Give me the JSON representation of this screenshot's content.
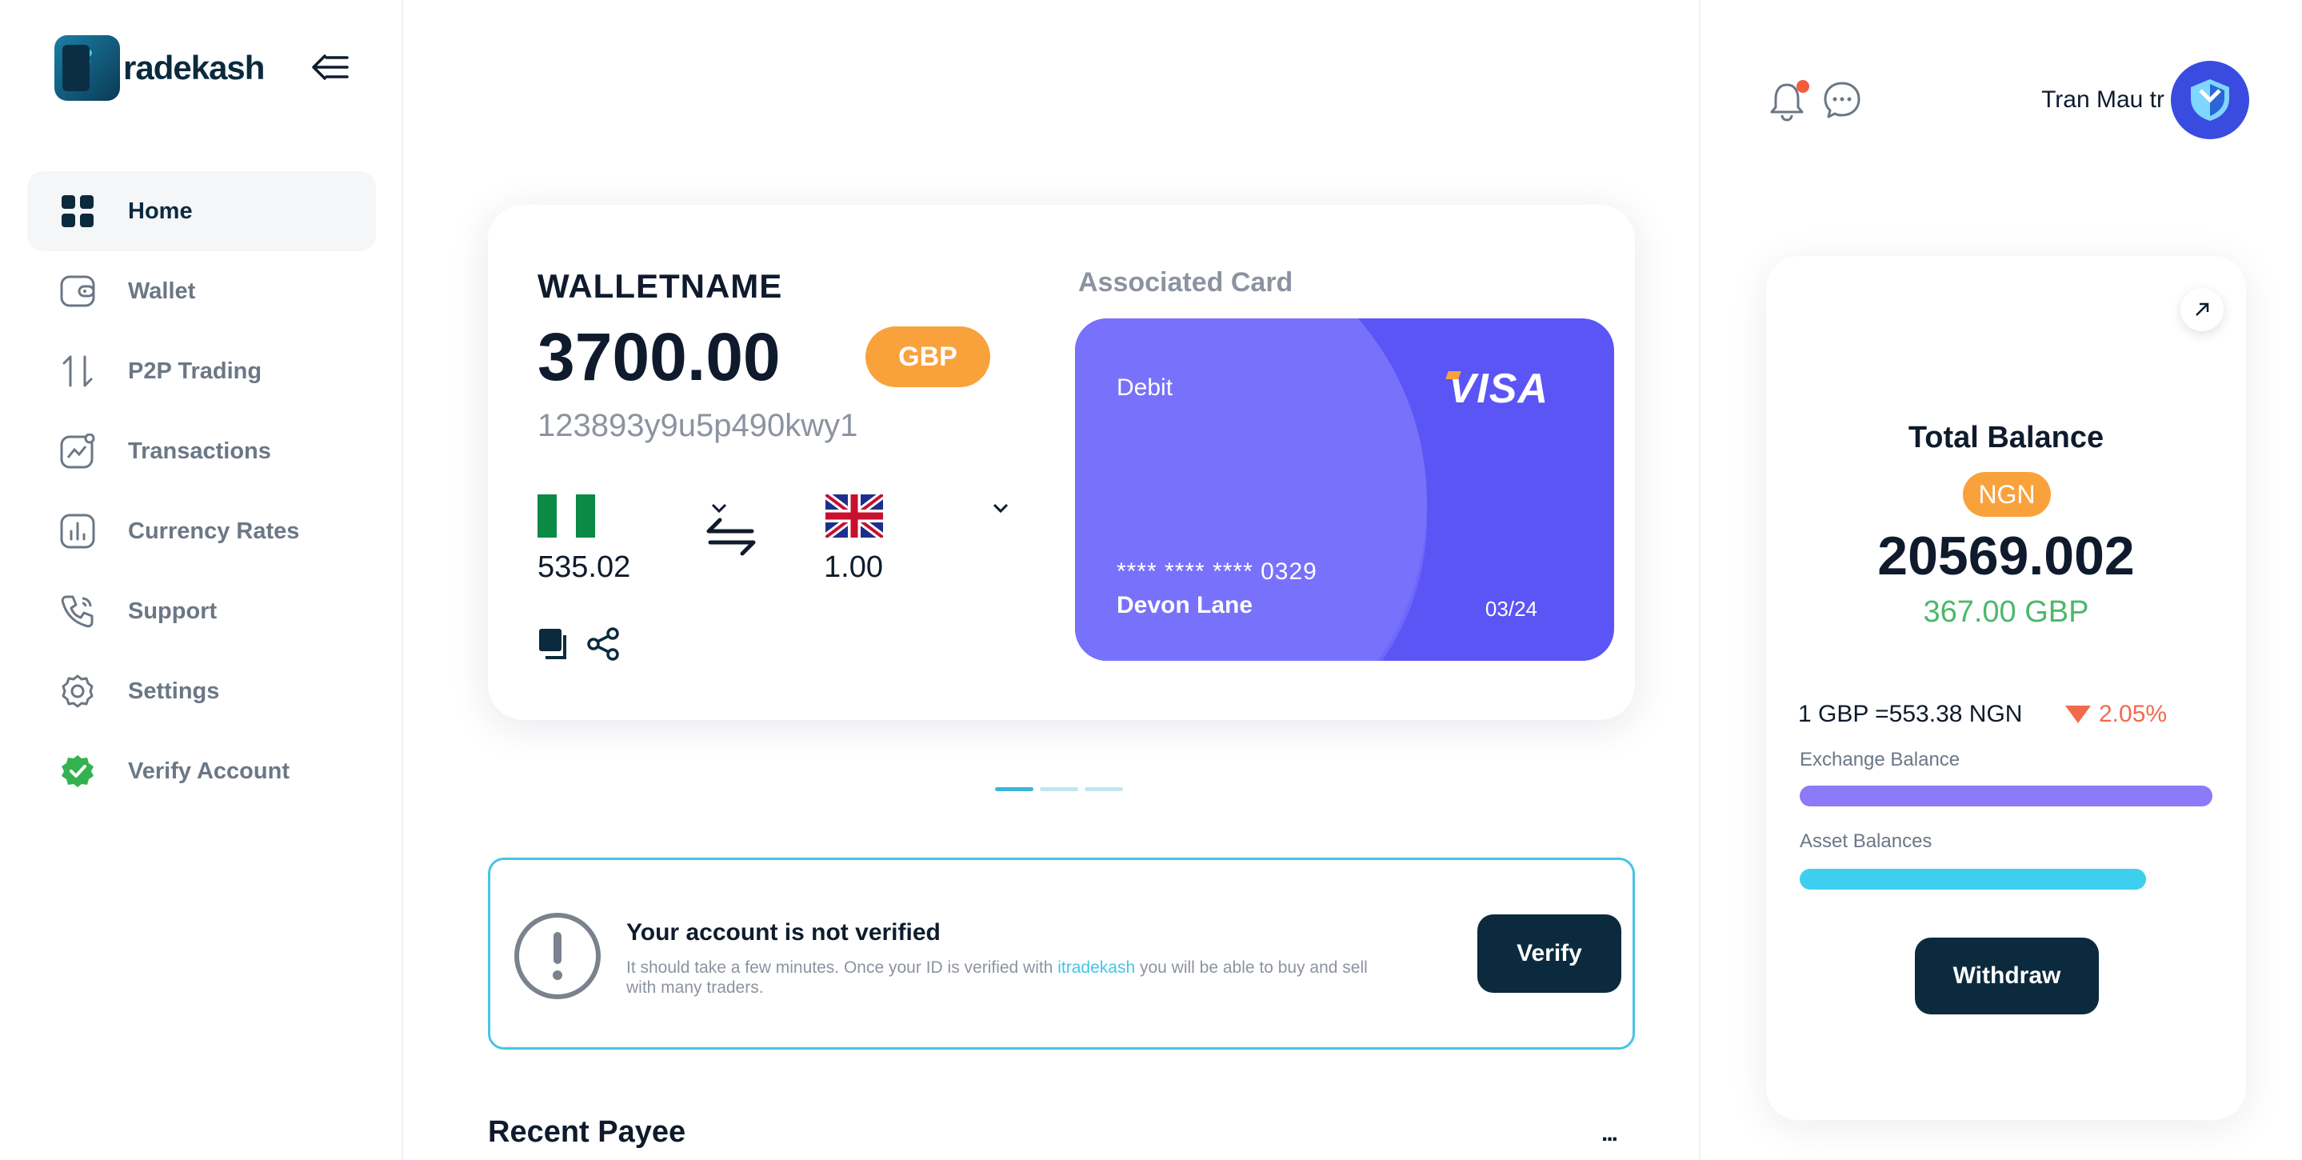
{
  "brand": {
    "name": "radekash",
    "mark_letter": "i"
  },
  "sidebar": {
    "items": [
      {
        "label": "Home",
        "icon": "grid-icon"
      },
      {
        "label": "Wallet",
        "icon": "wallet-icon"
      },
      {
        "label": "P2P Trading",
        "icon": "arrows-up-down-icon"
      },
      {
        "label": "Transactions",
        "icon": "chart-line-icon"
      },
      {
        "label": "Currency Rates",
        "icon": "bar-chart-icon"
      },
      {
        "label": "Support",
        "icon": "phone-icon"
      },
      {
        "label": "Settings",
        "icon": "gear-icon"
      },
      {
        "label": "Verify Account",
        "icon": "verified-check-icon"
      }
    ],
    "active": "Home"
  },
  "wallet": {
    "name": "WALLETNAME",
    "amount": "3700.00",
    "currency": "GBP",
    "id": "123893y9u5p490kwy1",
    "from_rate": "535.02",
    "to_rate": "1.00",
    "associated_label": "Associated Card",
    "card": {
      "type": "Debit",
      "brand": "VISA",
      "number": "**** **** **** 0329",
      "holder": "Devon Lane",
      "expiry": "03/24"
    }
  },
  "carousel": {
    "count": 3,
    "active": 0
  },
  "verify": {
    "title": "Your account is not verified",
    "text_before": "It should take a few minutes. Once your ID is verified with ",
    "text_brand": "itradekash",
    "text_after": " you will be able to buy and sell with many traders.",
    "button": "Verify"
  },
  "recent": {
    "title": "Recent Payee",
    "more": "..."
  },
  "header": {
    "user_name": "Tran Mau tr",
    "notifications_unread": true
  },
  "balance": {
    "title": "Total Balance",
    "currency": "NGN",
    "amount": "20569.002",
    "sub_amount": "367.00 GBP",
    "rate": "1 GBP =553.38 NGN",
    "change": "2.05%",
    "exchange_label": "Exchange Balance",
    "exchange_fraction": 1.0,
    "asset_label": "Asset Balances",
    "asset_fraction": 0.84,
    "withdraw": "Withdraw"
  },
  "colors": {
    "primary": "#0b2a3e",
    "accent_orange": "#f9a23c",
    "card_purple": "#5b55f6",
    "cyan": "#45c5e6",
    "exchange_bar": "#8d7af7",
    "asset_bar": "#3fcfee",
    "positive": "#4cb86a",
    "negative": "#f06a4d"
  }
}
